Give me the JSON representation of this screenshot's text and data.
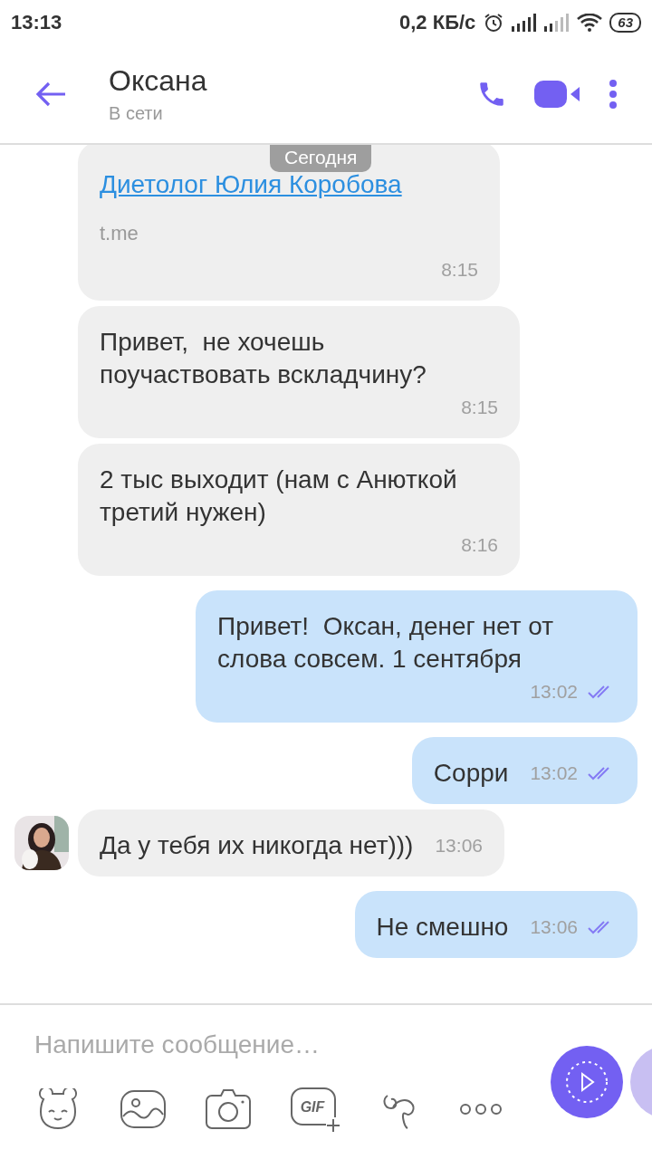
{
  "status_bar": {
    "time": "13:13",
    "speed": "0,2 КБ/с",
    "battery": "63"
  },
  "header": {
    "name": "Оксана",
    "status": "В сети"
  },
  "date_label": "Сегодня",
  "messages": [
    {
      "kind": "link",
      "outgoing": false,
      "link": "Диетолог Юлия Коробова",
      "domain": "t.me",
      "time": "8:15",
      "avatar": false
    },
    {
      "kind": "text",
      "outgoing": false,
      "text": "Привет,  не хочешь поучаствовать вскладчину?",
      "time": "8:15",
      "avatar": false
    },
    {
      "kind": "text",
      "outgoing": false,
      "text": "2 тыс выходит (нам с Анюткой третий нужен)",
      "time": "8:16",
      "avatar": false
    },
    {
      "kind": "text",
      "outgoing": true,
      "text": "Привет!  Оксан, денег нет от слова совсем. 1 сентября",
      "time": "13:02",
      "read": true
    },
    {
      "kind": "text",
      "outgoing": true,
      "text": "Сорри",
      "time": "13:02",
      "read": true
    },
    {
      "kind": "text",
      "outgoing": false,
      "text": "Да у тебя их никогда нет)))",
      "time": "13:06",
      "avatar": true
    },
    {
      "kind": "text",
      "outgoing": true,
      "text": "Не смешно",
      "time": "13:06",
      "read": true
    }
  ],
  "composer": {
    "placeholder": "Напишите сообщение…"
  },
  "tools": [
    {
      "kind": "sticker"
    },
    {
      "kind": "gallery"
    },
    {
      "kind": "camera"
    },
    {
      "kind": "gif",
      "label": "GIF"
    },
    {
      "kind": "doodle"
    },
    {
      "kind": "more"
    }
  ]
}
